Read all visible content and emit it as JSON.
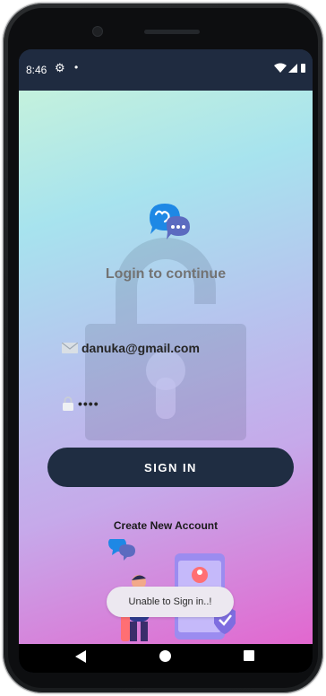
{
  "status_bar": {
    "time": "8:46",
    "settings_icon": "gear-icon",
    "notification_dot": "•",
    "wifi_icon": "wifi-icon",
    "signal_icon": "signal-icon",
    "battery_icon": "battery-icon"
  },
  "login": {
    "logo_icon": "chat-bubbles-logo",
    "title": "Login to continue",
    "email": {
      "icon": "envelope-icon",
      "value": "danuka@gmail.com"
    },
    "password": {
      "icon": "lock-icon",
      "value": "••••"
    },
    "sign_in_label": "SIGN IN",
    "create_account_label": "Create New Account",
    "background_icon": "open-padlock-icon",
    "illustration_icon": "login-illustration"
  },
  "toast": {
    "message": "Unable to Sign in..!"
  },
  "nav_bar": {
    "back": "back-triangle-icon",
    "home": "home-circle-icon",
    "recents": "recents-square-icon"
  },
  "colors": {
    "primary": "#1f2d42",
    "title_text": "#737373",
    "gradient": [
      "#c4f1dd",
      "#a7e3ee",
      "#b6c5ee",
      "#c6a9ea",
      "#e267cf"
    ]
  }
}
